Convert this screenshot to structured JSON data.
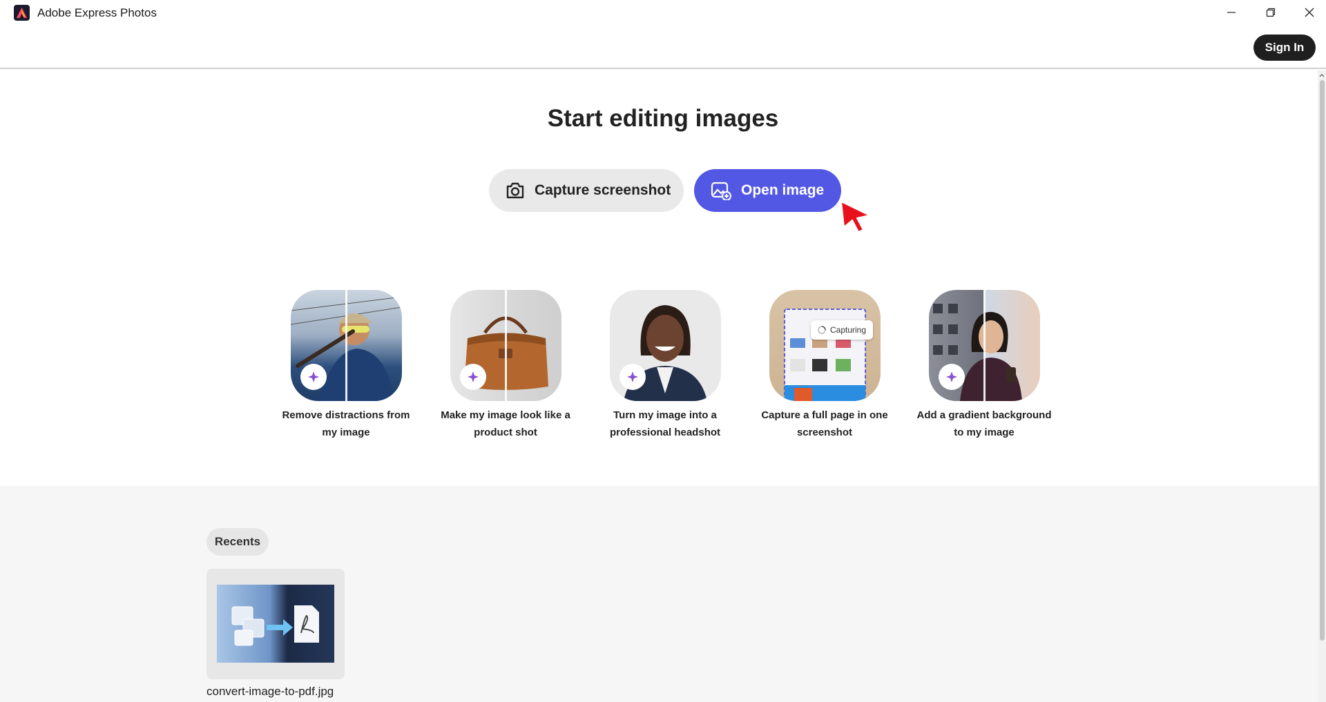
{
  "window": {
    "title": "Adobe Express Photos",
    "controls": [
      "minimize-icon",
      "restore-icon",
      "close-icon"
    ]
  },
  "header": {
    "sign_in_label": "Sign In"
  },
  "main": {
    "headline": "Start editing images",
    "capture_button": {
      "label": "Capture screenshot",
      "icon": "camera-icon"
    },
    "open_button": {
      "label": "Open image",
      "icon": "image-add-icon",
      "color": "#5258e4"
    },
    "quick_actions": [
      {
        "label": "Remove distractions from my image",
        "icon": "sparkle-icon"
      },
      {
        "label": "Make my image look like a product shot",
        "icon": "sparkle-icon"
      },
      {
        "label": "Turn my image into a professional headshot",
        "icon": "sparkle-icon"
      },
      {
        "label": "Capture a full page in one screenshot",
        "icon": "sparkle-icon",
        "overlay_text": "Capturing"
      },
      {
        "label": "Add a gradient background to my image",
        "icon": "sparkle-icon"
      }
    ]
  },
  "recents": {
    "label": "Recents",
    "items": [
      {
        "file_name": "convert-image-to-pdf.jpg"
      }
    ]
  },
  "colors": {
    "accent": "#5258e4",
    "sign_in_bg": "#1f1f1f",
    "recents_bg": "#f6f6f6"
  }
}
